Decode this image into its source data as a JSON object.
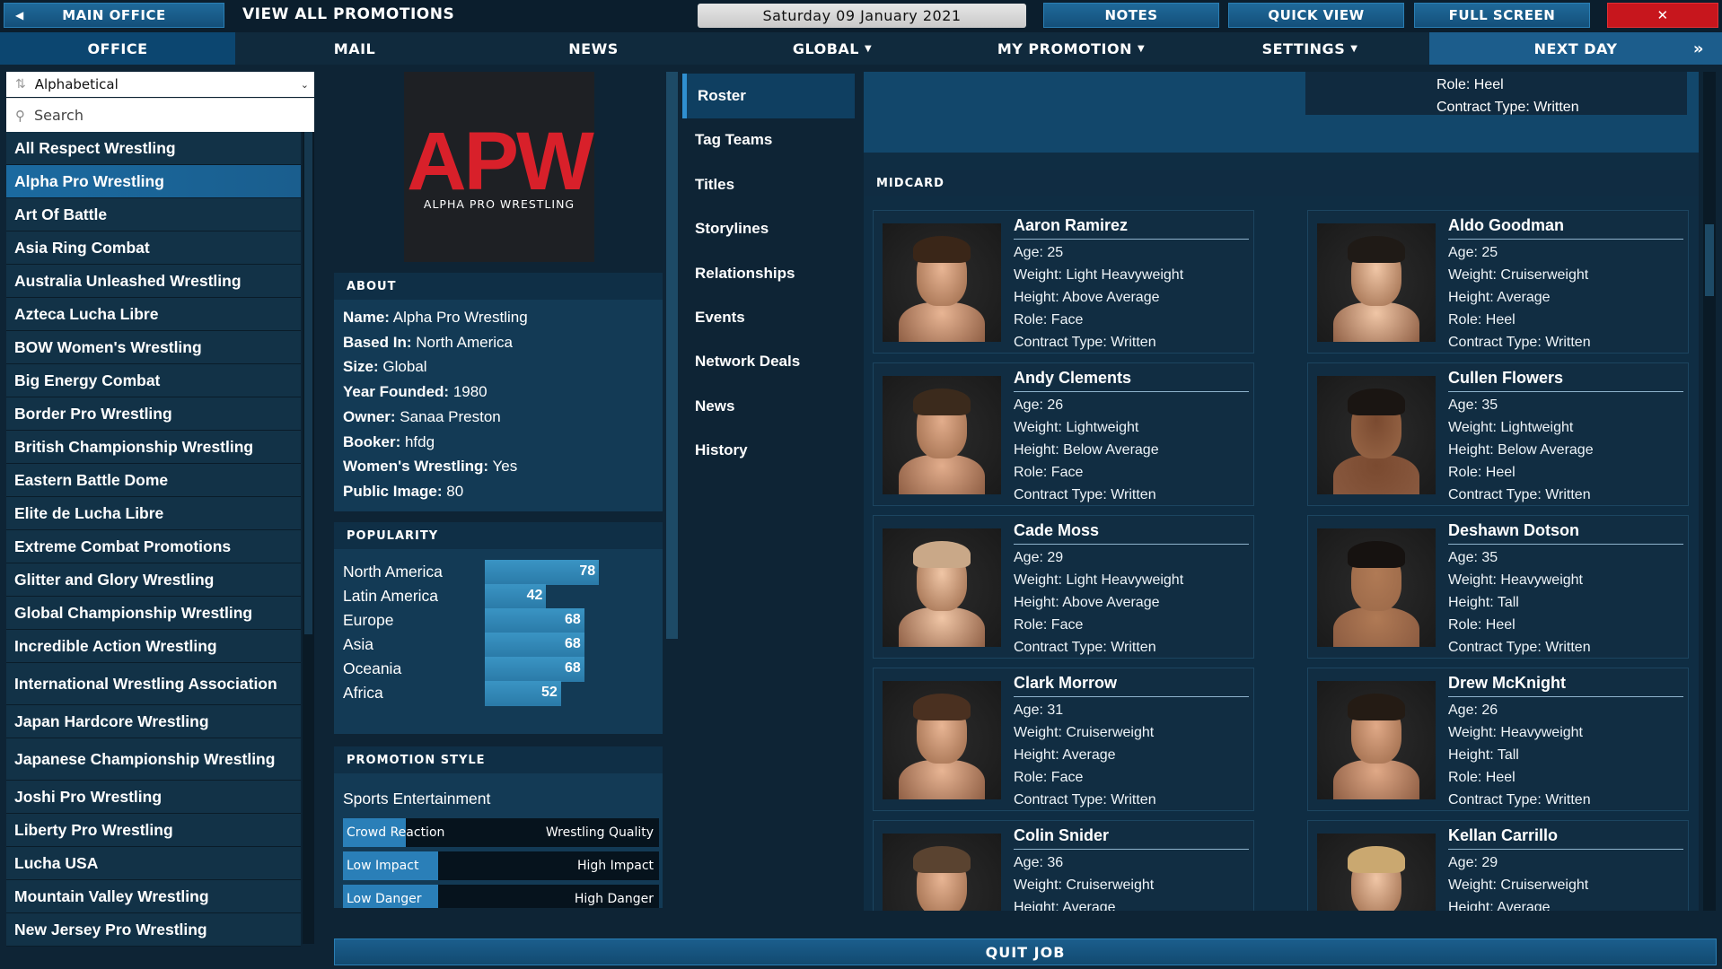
{
  "topbar": {
    "main_office": "MAIN OFFICE",
    "view_title": "VIEW ALL PROMOTIONS",
    "date": "Saturday 09 January 2021",
    "notes": "NOTES",
    "quick_view": "QUICK VIEW",
    "full_screen": "FULL SCREEN",
    "close": "✕"
  },
  "nav": {
    "office": "OFFICE",
    "mail": "MAIL",
    "news": "NEWS",
    "global": "GLOBAL",
    "my_promotion": "MY PROMOTION",
    "settings": "SETTINGS",
    "next_day": "NEXT DAY",
    "next_arrow": "»"
  },
  "sidebar": {
    "sort_value": "Alphabetical",
    "search_placeholder": "Search",
    "items": [
      {
        "label": "All Respect Wrestling"
      },
      {
        "label": "Alpha Pro Wrestling"
      },
      {
        "label": "Art Of Battle"
      },
      {
        "label": "Asia Ring Combat"
      },
      {
        "label": "Australia Unleashed Wrestling"
      },
      {
        "label": "Azteca Lucha Libre"
      },
      {
        "label": "BOW Women's Wrestling"
      },
      {
        "label": "Big Energy Combat"
      },
      {
        "label": "Border Pro Wrestling"
      },
      {
        "label": "British Championship Wrestling"
      },
      {
        "label": "Eastern Battle Dome"
      },
      {
        "label": "Elite de Lucha Libre"
      },
      {
        "label": "Extreme Combat Promotions"
      },
      {
        "label": "Glitter and Glory Wrestling"
      },
      {
        "label": "Global Championship Wrestling"
      },
      {
        "label": "Incredible Action Wrestling"
      },
      {
        "label": "International Wrestling Association"
      },
      {
        "label": "Japan Hardcore Wrestling"
      },
      {
        "label": "Japanese Championship Wrestling"
      },
      {
        "label": "Joshi Pro Wrestling"
      },
      {
        "label": "Liberty Pro Wrestling"
      },
      {
        "label": "Lucha USA"
      },
      {
        "label": "Mountain Valley Wrestling"
      },
      {
        "label": "New Jersey Pro Wrestling"
      }
    ]
  },
  "logo": {
    "big": "APW",
    "small": "ALPHA PRO WRESTLING",
    "color": "#d8202a"
  },
  "about": {
    "heading": "ABOUT",
    "lines": [
      {
        "key": "Name:",
        "value": "Alpha Pro Wrestling"
      },
      {
        "key": "Based In:",
        "value": "North America"
      },
      {
        "key": "Size:",
        "value": "Global"
      },
      {
        "key": "Year Founded:",
        "value": "1980"
      },
      {
        "key": "Owner:",
        "value": "Sanaa Preston"
      },
      {
        "key": "Booker:",
        "value": "hfdg"
      },
      {
        "key": "Women's Wrestling:",
        "value": "Yes"
      },
      {
        "key": "Public Image:",
        "value": "80"
      }
    ]
  },
  "popularity": {
    "heading": "POPULARITY",
    "rows": [
      {
        "region": "North America",
        "value": "78",
        "level": 78
      },
      {
        "region": "Latin America",
        "value": "42",
        "level": 42
      },
      {
        "region": "Europe",
        "value": "68",
        "level": 68
      },
      {
        "region": "Asia",
        "value": "68",
        "level": 68
      },
      {
        "region": "Oceania",
        "value": "68",
        "level": 68
      },
      {
        "region": "Africa",
        "value": "52",
        "level": 52
      }
    ]
  },
  "promotion_style": {
    "heading": "PROMOTION STYLE",
    "type": "Sports Entertainment",
    "sliders": [
      {
        "left": "Crowd Reaction",
        "right": "Wrestling Quality",
        "level": 0.2
      },
      {
        "left": "Low Impact",
        "right": "High Impact",
        "level": 0.3
      },
      {
        "left": "Low Danger",
        "right": "High Danger",
        "level": 0.3
      }
    ]
  },
  "subnav": {
    "items": [
      {
        "label": "Roster"
      },
      {
        "label": "Tag Teams"
      },
      {
        "label": "Titles"
      },
      {
        "label": "Storylines"
      },
      {
        "label": "Relationships"
      },
      {
        "label": "Events"
      },
      {
        "label": "Network Deals"
      },
      {
        "label": "News"
      },
      {
        "label": "History"
      }
    ]
  },
  "roster": {
    "top_card": {
      "role": "Role: Heel",
      "contract": "Contract Type: Written"
    },
    "midcard_heading": "MIDCARD",
    "cards": [
      {
        "name": "Aaron Ramirez",
        "age": "Age: 25",
        "weight": "Weight: Light Heavyweight",
        "height": "Height: Above Average",
        "role": "Role: Face",
        "contract": "Contract Type: Written"
      },
      {
        "name": "Aldo Goodman",
        "age": "Age: 25",
        "weight": "Weight: Cruiserweight",
        "height": "Height: Average",
        "role": "Role: Heel",
        "contract": "Contract Type: Written"
      },
      {
        "name": "Andy Clements",
        "age": "Age: 26",
        "weight": "Weight: Lightweight",
        "height": "Height: Below Average",
        "role": "Role: Face",
        "contract": "Contract Type: Written"
      },
      {
        "name": "Cullen Flowers",
        "age": "Age: 35",
        "weight": "Weight: Lightweight",
        "height": "Height: Below Average",
        "role": "Role: Heel",
        "contract": "Contract Type: Written"
      },
      {
        "name": "Cade Moss",
        "age": "Age: 29",
        "weight": "Weight: Light Heavyweight",
        "height": "Height: Above Average",
        "role": "Role: Face",
        "contract": "Contract Type: Written"
      },
      {
        "name": "Deshawn Dotson",
        "age": "Age: 35",
        "weight": "Weight: Heavyweight",
        "height": "Height: Tall",
        "role": "Role: Heel",
        "contract": "Contract Type: Written"
      },
      {
        "name": "Clark Morrow",
        "age": "Age: 31",
        "weight": "Weight: Cruiserweight",
        "height": "Height: Average",
        "role": "Role: Face",
        "contract": "Contract Type: Written"
      },
      {
        "name": "Drew McKnight",
        "age": "Age: 26",
        "weight": "Weight: Heavyweight",
        "height": "Height: Tall",
        "role": "Role: Heel",
        "contract": "Contract Type: Written"
      },
      {
        "name": "Colin Snider",
        "age": "Age: 36",
        "weight": "Weight: Cruiserweight",
        "height": "Height: Average",
        "role": "",
        "contract": ""
      },
      {
        "name": "Kellan Carrillo",
        "age": "Age: 29",
        "weight": "Weight: Cruiserweight",
        "height": "Height: Average",
        "role": "",
        "contract": ""
      }
    ]
  },
  "footer": {
    "quit": "QUIT JOB"
  }
}
